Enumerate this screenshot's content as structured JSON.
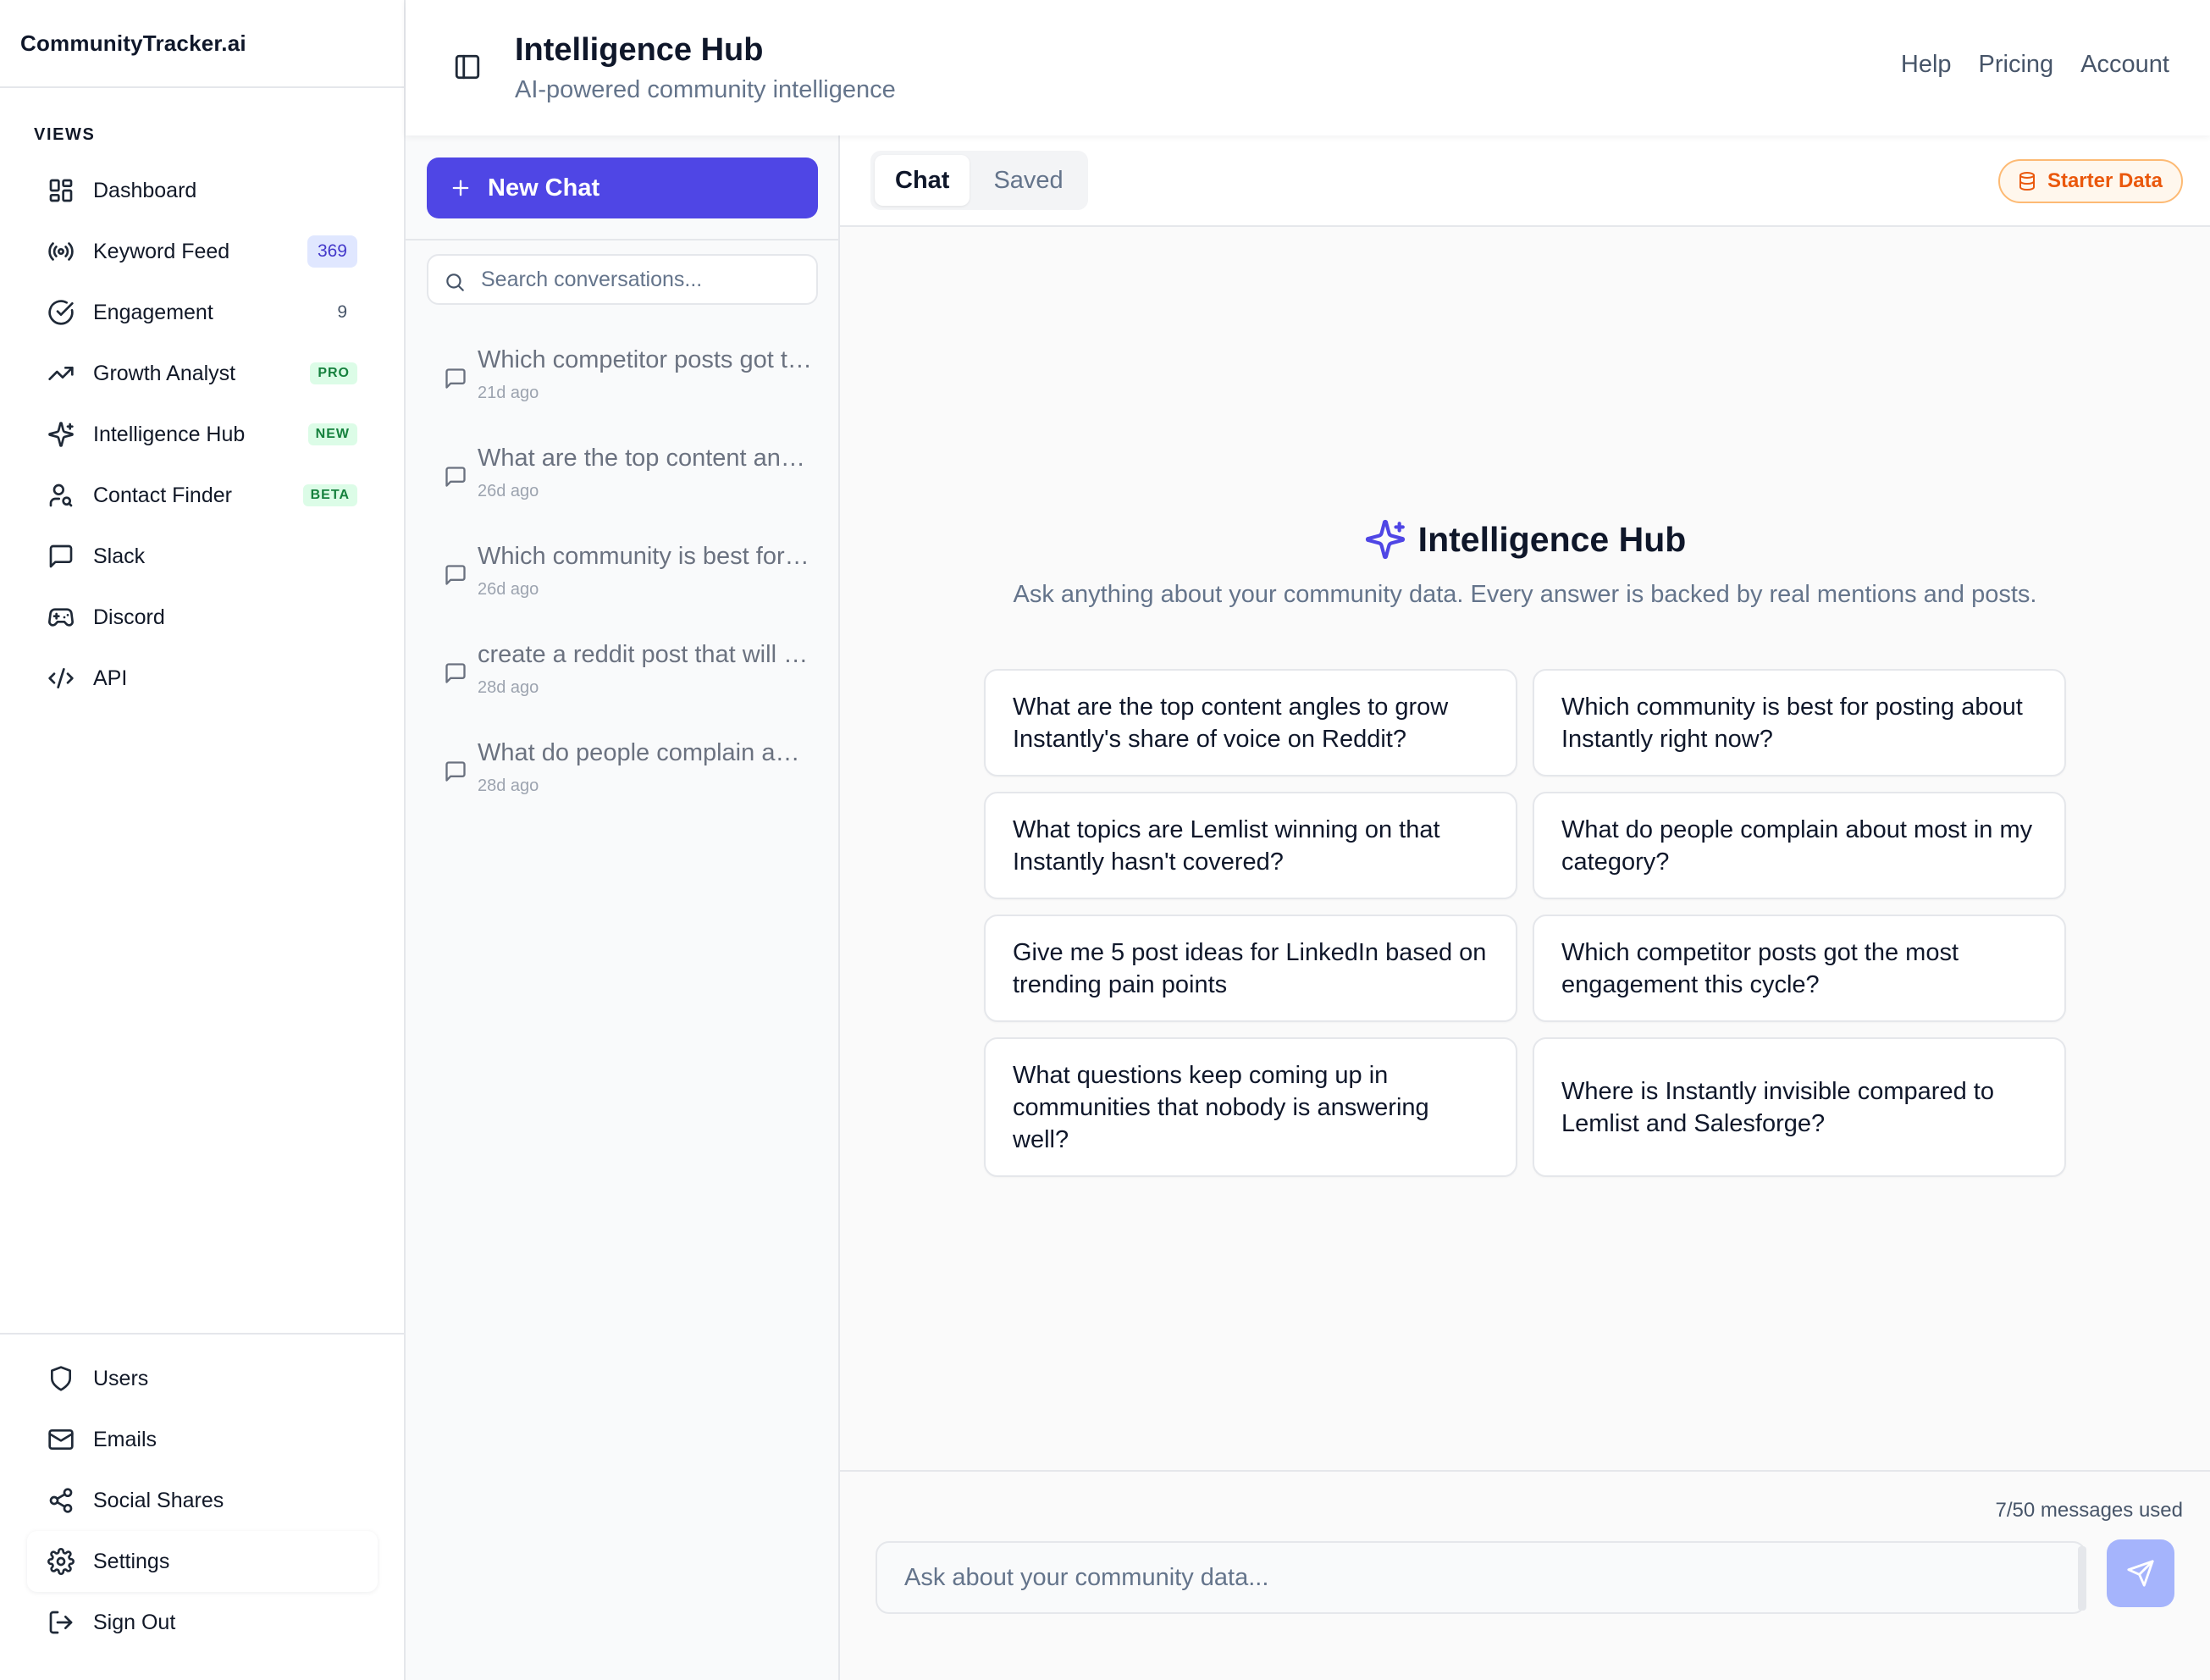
{
  "app": {
    "brand": "CommunityTracker.ai"
  },
  "sidebar": {
    "views_label": "VIEWS",
    "items": [
      {
        "label": "Dashboard",
        "icon": "dashboard-icon"
      },
      {
        "label": "Keyword Feed",
        "icon": "broadcast-icon",
        "badge": "369"
      },
      {
        "label": "Engagement",
        "icon": "check-circle-icon",
        "badge": "9"
      },
      {
        "label": "Growth Analyst",
        "icon": "trending-up-icon",
        "badge": "PRO"
      },
      {
        "label": "Intelligence Hub",
        "icon": "sparkles-icon",
        "badge": "NEW"
      },
      {
        "label": "Contact Finder",
        "icon": "user-search-icon",
        "badge": "BETA"
      },
      {
        "label": "Slack",
        "icon": "message-square-icon"
      },
      {
        "label": "Discord",
        "icon": "gamepad-icon"
      },
      {
        "label": "API",
        "icon": "code-icon"
      }
    ],
    "bottom_items": [
      {
        "label": "Users",
        "icon": "shield-icon"
      },
      {
        "label": "Emails",
        "icon": "mail-icon"
      },
      {
        "label": "Social Shares",
        "icon": "share-icon"
      },
      {
        "label": "Settings",
        "icon": "gear-icon"
      },
      {
        "label": "Sign Out",
        "icon": "sign-out-icon"
      }
    ]
  },
  "header": {
    "title": "Intelligence Hub",
    "subtitle": "AI-powered community intelligence",
    "links": [
      "Help",
      "Pricing",
      "Account"
    ]
  },
  "chat_list": {
    "new_chat_label": "New Chat",
    "search_placeholder": "Search conversations...",
    "conversations": [
      {
        "title": "Which competitor posts got the most engagement this cycle?",
        "time": "21d ago"
      },
      {
        "title": "What are the top content angles to grow Instantly's share of voice on Reddit?",
        "time": "26d ago"
      },
      {
        "title": "Which community is best for posting about Instantly right now?",
        "time": "26d ago"
      },
      {
        "title": "create a reddit post that will get engagement",
        "time": "28d ago"
      },
      {
        "title": "What do people complain about most in my category?",
        "time": "28d ago"
      }
    ]
  },
  "main": {
    "tabs": [
      "Chat",
      "Saved"
    ],
    "active_tab": "Chat",
    "data_badge": "Starter Data",
    "hub_title": "Intelligence Hub",
    "hub_description": "Ask anything about your community data. Every answer is backed by real mentions and posts.",
    "suggestions": [
      "What are the top content angles to grow Instantly's share of voice on Reddit?",
      "Which community is best for posting about Instantly right now?",
      "What topics are Lemlist winning on that Instantly hasn't covered?",
      "What do people complain about most in my category?",
      "Give me 5 post ideas for LinkedIn based on trending pain points",
      "Which competitor posts got the most engagement this cycle?",
      "What questions keep coming up in communities that nobody is answering well?",
      "Where is Instantly invisible compared to Lemlist and Salesforge?"
    ],
    "usage": "7/50 messages used",
    "composer_placeholder": "Ask about your community data..."
  },
  "colors": {
    "accent": "#4f46e5",
    "send_button": "#a5b4fc",
    "starter_badge": "#ea580c",
    "badge_green": "#15803d"
  }
}
